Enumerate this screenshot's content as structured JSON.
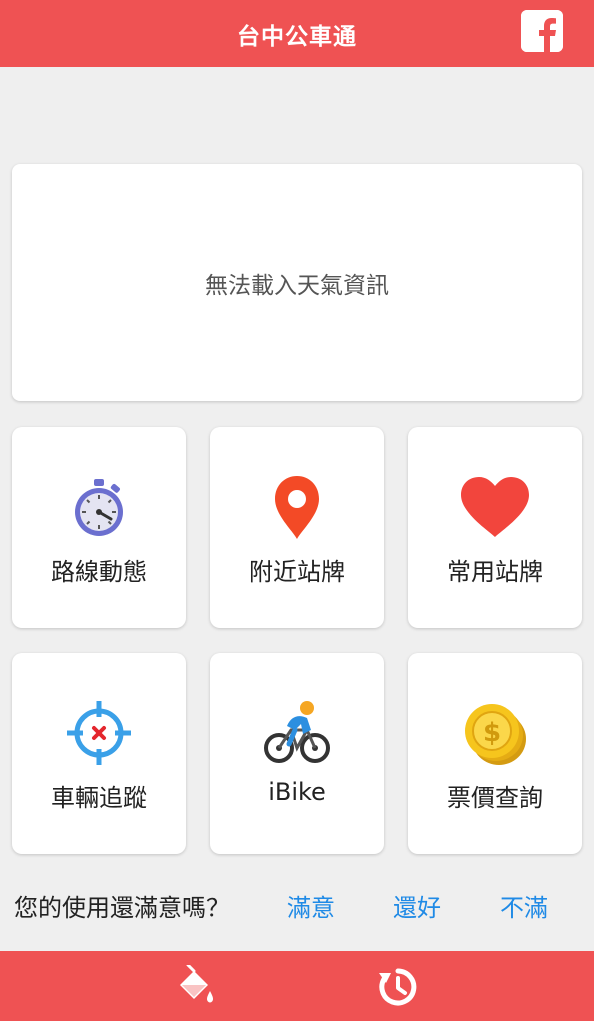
{
  "header": {
    "title": "台中公車通",
    "facebook_icon": "facebook-icon"
  },
  "weather": {
    "message": "無法載入天氣資訊"
  },
  "tiles": [
    {
      "label": "路線動態",
      "icon": "stopwatch-icon"
    },
    {
      "label": "附近站牌",
      "icon": "map-pin-icon"
    },
    {
      "label": "常用站牌",
      "icon": "heart-icon"
    },
    {
      "label": "車輛追蹤",
      "icon": "crosshair-icon"
    },
    {
      "label": "iBike",
      "icon": "cyclist-icon"
    },
    {
      "label": "票價查詢",
      "icon": "coins-icon"
    }
  ],
  "feedback": {
    "question": "您的使用還滿意嗎？",
    "options": [
      "滿意",
      "還好",
      "不滿"
    ]
  },
  "footer": {
    "icons": [
      "paint-bucket-icon",
      "history-icon"
    ]
  },
  "colors": {
    "brand": "#ef5253",
    "link": "#1f8ae6",
    "background": "#efefef"
  }
}
